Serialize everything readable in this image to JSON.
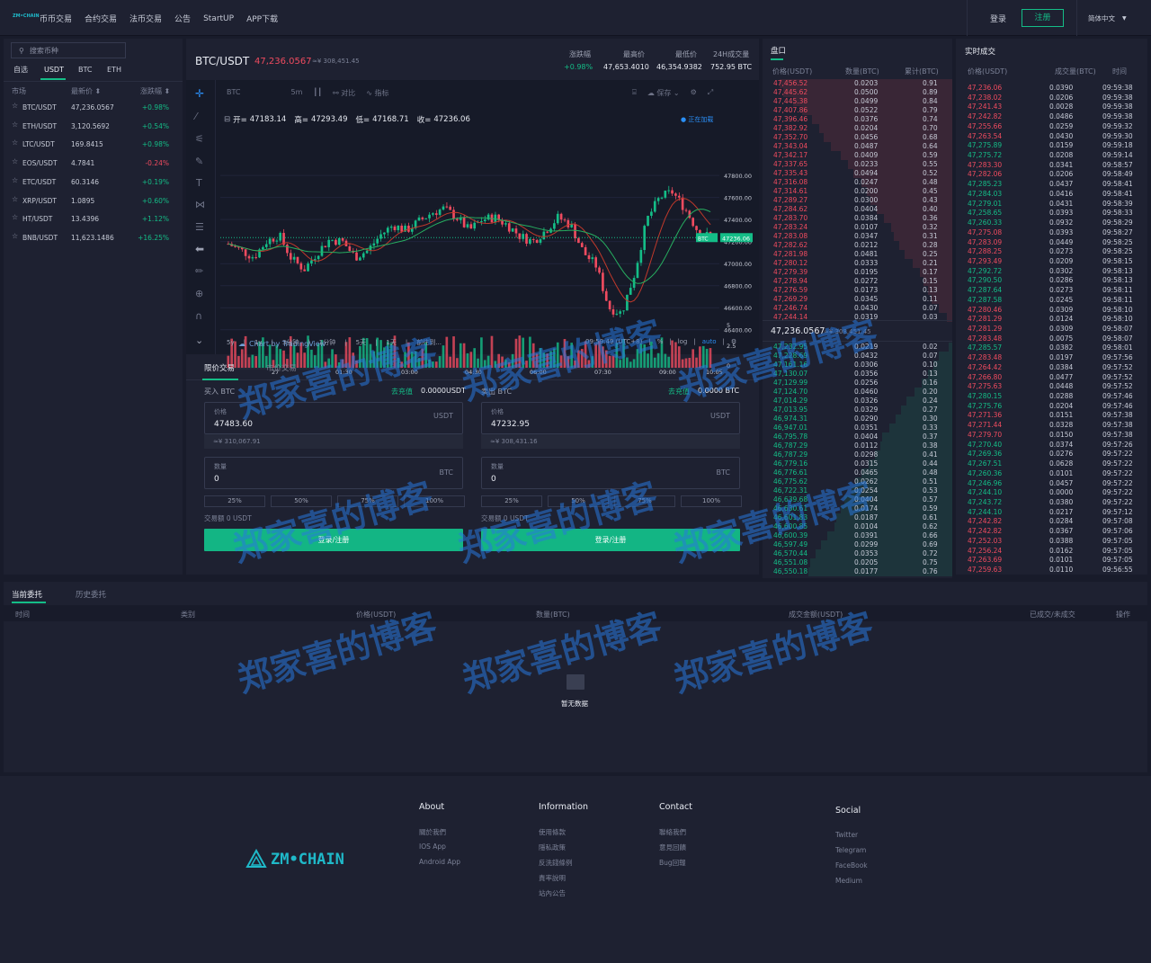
{
  "brand": {
    "small_logo": "ZM•CHAIN"
  },
  "nav": [
    "币币交易",
    "合约交易",
    "法币交易",
    "公告",
    "StartUP",
    "APP下载"
  ],
  "auth": {
    "login": "登录",
    "register": "注册",
    "lang": "简体中文"
  },
  "markets": {
    "search_placeholder": "搜索币种",
    "tabs": [
      "自选",
      "USDT",
      "BTC",
      "ETH"
    ],
    "active_tab": "USDT",
    "headers": {
      "market": "市场",
      "price": "最新价",
      "change": "涨跌幅"
    },
    "rows": [
      {
        "pair": "BTC/USDT",
        "price": "47,236.0567",
        "change": "+0.98%",
        "up": true
      },
      {
        "pair": "ETH/USDT",
        "price": "3,120.5692",
        "change": "+0.54%",
        "up": true
      },
      {
        "pair": "LTC/USDT",
        "price": "169.8415",
        "change": "+0.98%",
        "up": true
      },
      {
        "pair": "EOS/USDT",
        "price": "4.7841",
        "change": "-0.24%",
        "up": false
      },
      {
        "pair": "ETC/USDT",
        "price": "60.3146",
        "change": "+0.19%",
        "up": true
      },
      {
        "pair": "XRP/USDT",
        "price": "1.0895",
        "change": "+0.60%",
        "up": true
      },
      {
        "pair": "HT/USDT",
        "price": "13.4396",
        "change": "+1.12%",
        "up": true
      },
      {
        "pair": "BNB/USDT",
        "price": "11,623.1486",
        "change": "+16.25%",
        "up": true
      }
    ]
  },
  "ticker": {
    "pair": "BTC/USDT",
    "price": "47,236.0567",
    "cny": "≈¥ 308,451.45",
    "change_label": "涨跌幅",
    "change": "+0.98%",
    "high_label": "最高价",
    "high": "47,653.4010",
    "low_label": "最低价",
    "low": "46,354.9382",
    "vol_label": "24H成交量",
    "vol": "752.95 BTC"
  },
  "chart": {
    "symbol": "BTC",
    "interval": "5m",
    "compare": "对比",
    "indicators": "指标",
    "save": "保存",
    "ohlc": {
      "open_l": "开=",
      "open": "47183.14",
      "high_l": "高=",
      "high": "47293.49",
      "low_l": "低=",
      "low": "47168.71",
      "close_l": "收=",
      "close": "47236.06"
    },
    "loading": "● 正在加载",
    "last_label": "BTC",
    "last_price": "47236.06",
    "y_ticks": [
      "47800.00",
      "47600.00",
      "47400.00",
      "47200.00",
      "47000.00",
      "46800.00",
      "46600.00",
      "46400.00"
    ],
    "vol_ticks": [
      "5",
      "2.5",
      "0"
    ],
    "x_ticks": [
      "27",
      "01:30",
      "03:00",
      "04:30",
      "06:00",
      "07:30",
      "09:00",
      "10:05"
    ],
    "ranges": [
      "5y",
      "1y",
      "3分钟",
      "1分钟",
      "5天",
      "1天",
      "前往到..."
    ],
    "time": "09:59:49 (UTC+8)",
    "pct": "%",
    "log": "log",
    "auto": "auto",
    "credit": "Chart by TradingView"
  },
  "trade": {
    "tabs": [
      "限价交易",
      "市价交易"
    ],
    "buy": {
      "title": "买入 BTC",
      "recharge": "去充值",
      "balance": "0.0000USDT",
      "price_label": "价格",
      "unit": "USDT",
      "price": "47483.60",
      "cny": "≈¥ 310,067.91",
      "qty_label": "数量",
      "qty_unit": "BTC",
      "qty": "0",
      "amount": "交易额 0 USDT",
      "button": "登录/注册"
    },
    "sell": {
      "title": "卖出 BTC",
      "recharge": "去充值",
      "balance": "0.0000 BTC",
      "price_label": "价格",
      "unit": "USDT",
      "price": "47232.95",
      "cny": "≈¥ 308,431.16",
      "qty_label": "数量",
      "qty_unit": "BTC",
      "qty": "0",
      "amount": "交易额 0 USDT",
      "button": "登录/注册"
    },
    "pcts": [
      "25%",
      "50%",
      "75%",
      "100%"
    ]
  },
  "book": {
    "title": "盘口",
    "headers": [
      "价格(USDT)",
      "数量(BTC)",
      "累计(BTC)"
    ],
    "mid": "47,236.0567",
    "mid_cny": "≈¥ 308,451.45",
    "asks": [
      [
        "47,456.52",
        "0.0203",
        "0.91"
      ],
      [
        "47,445.62",
        "0.0500",
        "0.89"
      ],
      [
        "47,445.38",
        "0.0499",
        "0.84"
      ],
      [
        "47,407.86",
        "0.0522",
        "0.79"
      ],
      [
        "47,396.46",
        "0.0376",
        "0.74"
      ],
      [
        "47,382.92",
        "0.0204",
        "0.70"
      ],
      [
        "47,352.70",
        "0.0456",
        "0.68"
      ],
      [
        "47,343.04",
        "0.0487",
        "0.64"
      ],
      [
        "47,342.17",
        "0.0409",
        "0.59"
      ],
      [
        "47,337.65",
        "0.0233",
        "0.55"
      ],
      [
        "47,335.43",
        "0.0494",
        "0.52"
      ],
      [
        "47,316.08",
        "0.0247",
        "0.48"
      ],
      [
        "47,314.61",
        "0.0200",
        "0.45"
      ],
      [
        "47,289.27",
        "0.0300",
        "0.43"
      ],
      [
        "47,284.62",
        "0.0404",
        "0.40"
      ],
      [
        "47,283.70",
        "0.0384",
        "0.36"
      ],
      [
        "47,283.24",
        "0.0107",
        "0.32"
      ],
      [
        "47,283.08",
        "0.0347",
        "0.31"
      ],
      [
        "47,282.62",
        "0.0212",
        "0.28"
      ],
      [
        "47,281.98",
        "0.0481",
        "0.25"
      ],
      [
        "47,280.12",
        "0.0333",
        "0.21"
      ],
      [
        "47,279.39",
        "0.0195",
        "0.17"
      ],
      [
        "47,278.94",
        "0.0272",
        "0.15"
      ],
      [
        "47,276.59",
        "0.0173",
        "0.13"
      ],
      [
        "47,269.29",
        "0.0345",
        "0.11"
      ],
      [
        "47,246.74",
        "0.0430",
        "0.07"
      ],
      [
        "47,244.14",
        "0.0319",
        "0.03"
      ]
    ],
    "bids": [
      [
        "47,232.95",
        "0.0219",
        "0.02"
      ],
      [
        "47,228.69",
        "0.0432",
        "0.07"
      ],
      [
        "47,161.16",
        "0.0306",
        "0.10"
      ],
      [
        "47,130.07",
        "0.0356",
        "0.13"
      ],
      [
        "47,129.99",
        "0.0256",
        "0.16"
      ],
      [
        "47,124.70",
        "0.0460",
        "0.20"
      ],
      [
        "47,014.29",
        "0.0326",
        "0.24"
      ],
      [
        "47,013.95",
        "0.0329",
        "0.27"
      ],
      [
        "46,974.31",
        "0.0290",
        "0.30"
      ],
      [
        "46,947.01",
        "0.0351",
        "0.33"
      ],
      [
        "46,795.78",
        "0.0404",
        "0.37"
      ],
      [
        "46,787.29",
        "0.0112",
        "0.38"
      ],
      [
        "46,787.29",
        "0.0298",
        "0.41"
      ],
      [
        "46,779.16",
        "0.0315",
        "0.44"
      ],
      [
        "46,776.61",
        "0.0465",
        "0.48"
      ],
      [
        "46,775.62",
        "0.0262",
        "0.51"
      ],
      [
        "46,722.31",
        "0.0254",
        "0.53"
      ],
      [
        "46,639.68",
        "0.0404",
        "0.57"
      ],
      [
        "46,630.61",
        "0.0174",
        "0.59"
      ],
      [
        "46,601.83",
        "0.0187",
        "0.61"
      ],
      [
        "46,600.85",
        "0.0104",
        "0.62"
      ],
      [
        "46,600.39",
        "0.0391",
        "0.66"
      ],
      [
        "46,597.49",
        "0.0299",
        "0.69"
      ],
      [
        "46,570.44",
        "0.0353",
        "0.72"
      ],
      [
        "46,551.08",
        "0.0205",
        "0.75"
      ],
      [
        "46,550.18",
        "0.0177",
        "0.76"
      ]
    ]
  },
  "trades": {
    "title": "实时成交",
    "headers": [
      "价格(USDT)",
      "成交量(BTC)",
      "时间"
    ],
    "rows": [
      [
        "47,236.06",
        "0.0390",
        "09:59:38",
        1
      ],
      [
        "47,238.02",
        "0.0206",
        "09:59:38",
        1
      ],
      [
        "47,241.43",
        "0.0028",
        "09:59:38",
        1
      ],
      [
        "47,242.82",
        "0.0486",
        "09:59:38",
        1
      ],
      [
        "47,255.66",
        "0.0259",
        "09:59:32",
        1
      ],
      [
        "47,263.54",
        "0.0430",
        "09:59:30",
        1
      ],
      [
        "47,275.89",
        "0.0159",
        "09:59:18",
        0
      ],
      [
        "47,275.72",
        "0.0208",
        "09:59:14",
        0
      ],
      [
        "47,283.30",
        "0.0341",
        "09:58:57",
        1
      ],
      [
        "47,282.06",
        "0.0206",
        "09:58:49",
        1
      ],
      [
        "47,285.23",
        "0.0437",
        "09:58:41",
        0
      ],
      [
        "47,284.03",
        "0.0416",
        "09:58:41",
        0
      ],
      [
        "47,279.01",
        "0.0431",
        "09:58:39",
        0
      ],
      [
        "47,258.65",
        "0.0393",
        "09:58:33",
        0
      ],
      [
        "47,260.33",
        "0.0932",
        "09:58:29",
        0
      ],
      [
        "47,275.08",
        "0.0393",
        "09:58:27",
        1
      ],
      [
        "47,283.09",
        "0.0449",
        "09:58:25",
        1
      ],
      [
        "47,288.25",
        "0.0273",
        "09:58:25",
        1
      ],
      [
        "47,293.49",
        "0.0209",
        "09:58:15",
        1
      ],
      [
        "47,292.72",
        "0.0302",
        "09:58:13",
        0
      ],
      [
        "47,290.50",
        "0.0286",
        "09:58:13",
        0
      ],
      [
        "47,287.64",
        "0.0273",
        "09:58:11",
        0
      ],
      [
        "47,287.58",
        "0.0245",
        "09:58:11",
        0
      ],
      [
        "47,280.46",
        "0.0309",
        "09:58:10",
        1
      ],
      [
        "47,281.29",
        "0.0124",
        "09:58:10",
        1
      ],
      [
        "47,281.29",
        "0.0309",
        "09:58:07",
        1
      ],
      [
        "47,283.48",
        "0.0075",
        "09:58:07",
        1
      ],
      [
        "47,285.57",
        "0.0382",
        "09:58:01",
        0
      ],
      [
        "47,283.48",
        "0.0197",
        "09:57:56",
        1
      ],
      [
        "47,264.42",
        "0.0384",
        "09:57:52",
        1
      ],
      [
        "47,266.80",
        "0.0477",
        "09:57:52",
        1
      ],
      [
        "47,275.63",
        "0.0448",
        "09:57:52",
        1
      ],
      [
        "47,280.15",
        "0.0288",
        "09:57:46",
        0
      ],
      [
        "47,275.76",
        "0.0204",
        "09:57:46",
        0
      ],
      [
        "47,271.36",
        "0.0151",
        "09:57:38",
        1
      ],
      [
        "47,271.44",
        "0.0328",
        "09:57:38",
        1
      ],
      [
        "47,279.70",
        "0.0150",
        "09:57:38",
        1
      ],
      [
        "47,270.40",
        "0.0374",
        "09:57:26",
        0
      ],
      [
        "47,269.36",
        "0.0276",
        "09:57:22",
        0
      ],
      [
        "47,267.51",
        "0.0628",
        "09:57:22",
        0
      ],
      [
        "47,260.36",
        "0.0101",
        "09:57:22",
        0
      ],
      [
        "47,246.96",
        "0.0457",
        "09:57:22",
        0
      ],
      [
        "47,244.10",
        "0.0000",
        "09:57:22",
        0
      ],
      [
        "47,243.72",
        "0.0380",
        "09:57:22",
        0
      ],
      [
        "47,244.10",
        "0.0217",
        "09:57:12",
        0
      ],
      [
        "47,242.82",
        "0.0284",
        "09:57:08",
        1
      ],
      [
        "47,242.82",
        "0.0367",
        "09:57:06",
        1
      ],
      [
        "47,252.03",
        "0.0388",
        "09:57:05",
        1
      ],
      [
        "47,256.24",
        "0.0162",
        "09:57:05",
        1
      ],
      [
        "47,263.69",
        "0.0101",
        "09:57:05",
        1
      ],
      [
        "47,259.63",
        "0.0110",
        "09:56:55",
        1
      ]
    ]
  },
  "orders": {
    "tabs": [
      "当前委托",
      "历史委托"
    ],
    "headers": [
      "时间",
      "类别",
      "价格(USDT)",
      "数量(BTC)",
      "成交金额(USDT)",
      "已成交/未成交",
      "操作"
    ],
    "empty": "暂无数据"
  },
  "footer": {
    "logo": "ZM•CHAIN",
    "cols": [
      {
        "title": "About",
        "items": [
          "關於我們",
          "IOS App",
          "Android App"
        ]
      },
      {
        "title": "Information",
        "items": [
          "使用條款",
          "隱私政策",
          "反洗錢條例",
          "責率說明",
          "站內公告"
        ]
      },
      {
        "title": "Contact",
        "items": [
          "聯絡我們",
          "意見回饋",
          "Bug回報"
        ]
      },
      {
        "title": "Social",
        "items": [
          "Twitter",
          "Telegram",
          "FaceBook",
          "Medium"
        ]
      }
    ]
  },
  "watermark": "郑家喜的博客",
  "colors": {
    "up": "#14bd87",
    "down": "#ef4b5f",
    "bg": "#181b2a",
    "panel": "#1e2131"
  }
}
